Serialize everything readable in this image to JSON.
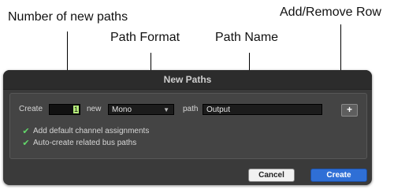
{
  "annotations": {
    "number_of_new_paths": "Number of new paths",
    "path_format": "Path Format",
    "path_name": "Path Name",
    "add_remove_row": "Add/Remove Row"
  },
  "dialog": {
    "title": "New Paths",
    "create_label": "Create",
    "create_count": "1",
    "new_label": "new",
    "format_value": "Mono",
    "path_label": "path",
    "path_value": "Output",
    "add_row_button": "+",
    "checkboxes": [
      {
        "label": "Add default channel assignments",
        "checked": true
      },
      {
        "label": "Auto-create related bus paths",
        "checked": true
      }
    ],
    "cancel_button": "Cancel",
    "create_button": "Create"
  },
  "colors": {
    "primary_button": "#2f6fd6",
    "checkbox_check": "#63d86a"
  }
}
